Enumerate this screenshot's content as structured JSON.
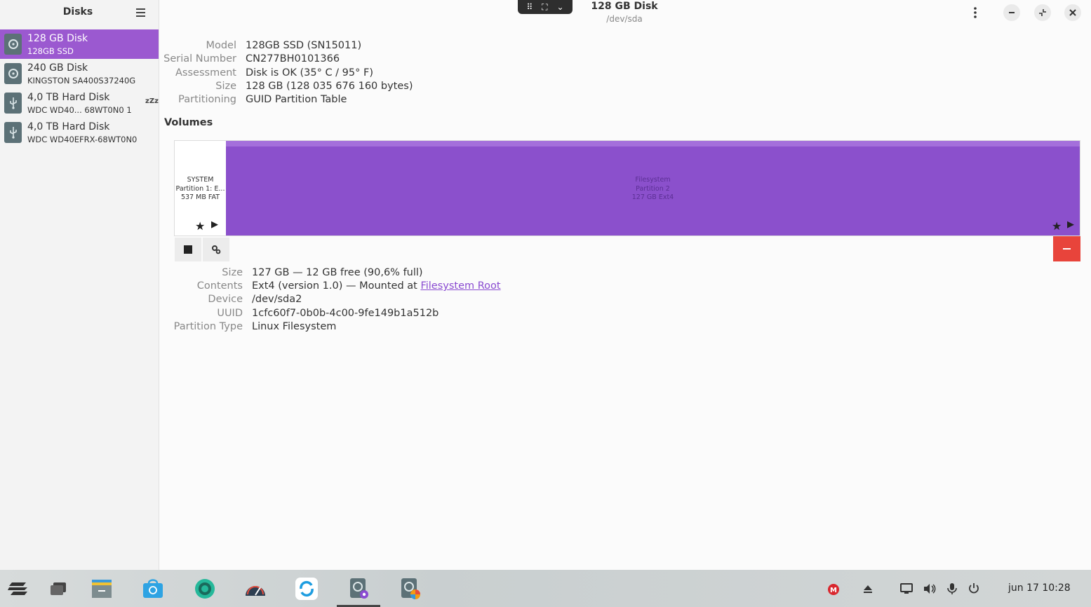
{
  "sidebar": {
    "title": "Disks",
    "disks": [
      {
        "name": "128 GB Disk",
        "sub": "128GB SSD",
        "icon": "ssd-icon",
        "selected": true
      },
      {
        "name": "240 GB Disk",
        "sub": "KINGSTON SA400S37240G",
        "icon": "ssd-icon"
      },
      {
        "name": "4,0 TB Hard Disk",
        "sub": "WDC WD40...  68WT0N0  1",
        "icon": "usb-drive-icon",
        "sleep": "zZz"
      },
      {
        "name": "4,0 TB Hard Disk",
        "sub": "WDC WD40EFRX-68WT0N0",
        "icon": "usb-drive-icon"
      }
    ]
  },
  "header": {
    "title": "128 GB Disk",
    "subtitle": "/dev/sda"
  },
  "disk_info": [
    {
      "key": "Model",
      "value": "128GB SSD (SN15011)"
    },
    {
      "key": "Serial Number",
      "value": "CN277BH0101366"
    },
    {
      "key": "Assessment",
      "value": "Disk is OK (35° C / 95° F)"
    },
    {
      "key": "Size",
      "value": "128 GB (128 035 676 160 bytes)"
    },
    {
      "key": "Partitioning",
      "value": "GUID Partition Table"
    }
  ],
  "volumes_label": "Volumes",
  "partitions": [
    {
      "line1": "SYSTEM",
      "line2": "Partition 1: E...",
      "line3": "537 MB FAT"
    },
    {
      "line1": "Filesystem",
      "line2": "Partition 2",
      "line3": "127 GB Ext4"
    }
  ],
  "volume_info": {
    "size_key": "Size",
    "size_value": "127 GB — 12 GB free (90,6% full)",
    "contents_key": "Contents",
    "contents_value": "Ext4 (version 1.0) — Mounted at ",
    "contents_link": "Filesystem Root",
    "device_key": "Device",
    "device_value": "/dev/sda2",
    "uuid_key": "UUID",
    "uuid_value": "1cfc60f7-0b0b-4c00-9fe149b1a512b",
    "ptype_key": "Partition Type",
    "ptype_value": "Linux Filesystem"
  },
  "taskbar": {
    "clock": "jun 17  10:28"
  },
  "colors": {
    "accent": "#9b59d0",
    "partition_fill": "#8b50cc",
    "delete": "#e8443b"
  }
}
